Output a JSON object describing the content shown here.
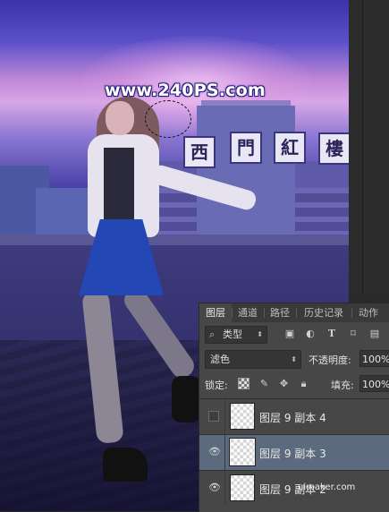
{
  "watermark": "www.240PS.com",
  "signs": [
    "西",
    "門",
    "紅",
    "樓"
  ],
  "panel": {
    "tabs": [
      {
        "label": "图层",
        "active": true
      },
      {
        "label": "通道",
        "active": false
      },
      {
        "label": "路径",
        "active": false
      },
      {
        "label": "历史记录",
        "active": false
      },
      {
        "label": "动作",
        "active": false
      }
    ],
    "filter_kind": "类型",
    "blend_mode": "滤色",
    "opacity_label": "不透明度:",
    "opacity_value": "100%",
    "lock_label": "锁定:",
    "fill_label": "填充:",
    "fill_value": "100%",
    "layers": [
      {
        "name": "图层 9 副本 4",
        "visible": false,
        "selected": false
      },
      {
        "name": "图层 9 副本 3",
        "visible": true,
        "selected": true
      },
      {
        "name": "图层 9 副本 2",
        "visible": true,
        "selected": false
      }
    ]
  },
  "site_mark": "uimaker.com",
  "icons": {
    "search": "search-icon",
    "image_filter": "image-filter-icon",
    "adjust_filter": "adjustment-filter-icon",
    "type_filter": "type-filter-icon",
    "shape_filter": "shape-filter-icon",
    "smart_filter": "smart-object-filter-icon",
    "eye": "eye-icon"
  },
  "colors": {
    "panel_bg": "#474747",
    "selected_row": "#5c6a7d"
  }
}
